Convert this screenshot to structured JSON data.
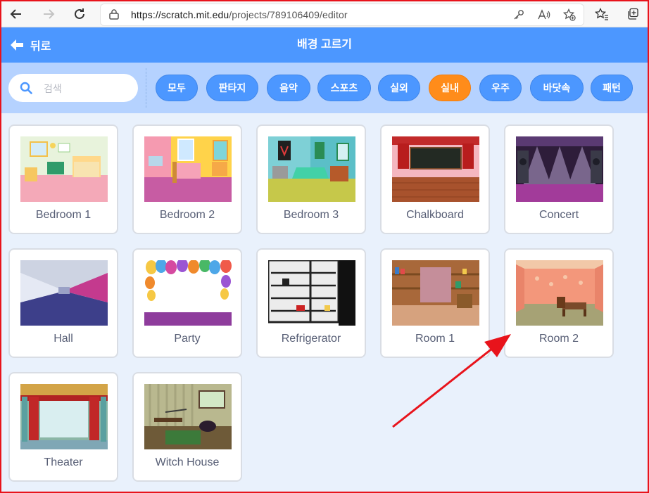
{
  "browser": {
    "url_host": "https://scratch.mit.edu",
    "url_path": "/projects/789106409/editor"
  },
  "header": {
    "back_label": "뒤로",
    "title": "배경 고르기"
  },
  "search": {
    "placeholder": "검색"
  },
  "tags": [
    "모두",
    "판타지",
    "음악",
    "스포츠",
    "실외",
    "실내",
    "우주",
    "바닷속",
    "패턴"
  ],
  "active_tag": "실내",
  "backdrops": [
    {
      "label": "Bedroom 1"
    },
    {
      "label": "Bedroom 2"
    },
    {
      "label": "Bedroom 3"
    },
    {
      "label": "Chalkboard"
    },
    {
      "label": "Concert"
    },
    {
      "label": "Hall"
    },
    {
      "label": "Party"
    },
    {
      "label": "Refrigerator"
    },
    {
      "label": "Room 1"
    },
    {
      "label": "Room 2"
    },
    {
      "label": "Theater"
    },
    {
      "label": "Witch House"
    }
  ],
  "colors": {
    "header": "#4c97ff",
    "filterbar": "#b5d2ff",
    "active_tag": "#ff8c1a",
    "annotation": "#e8131b"
  }
}
